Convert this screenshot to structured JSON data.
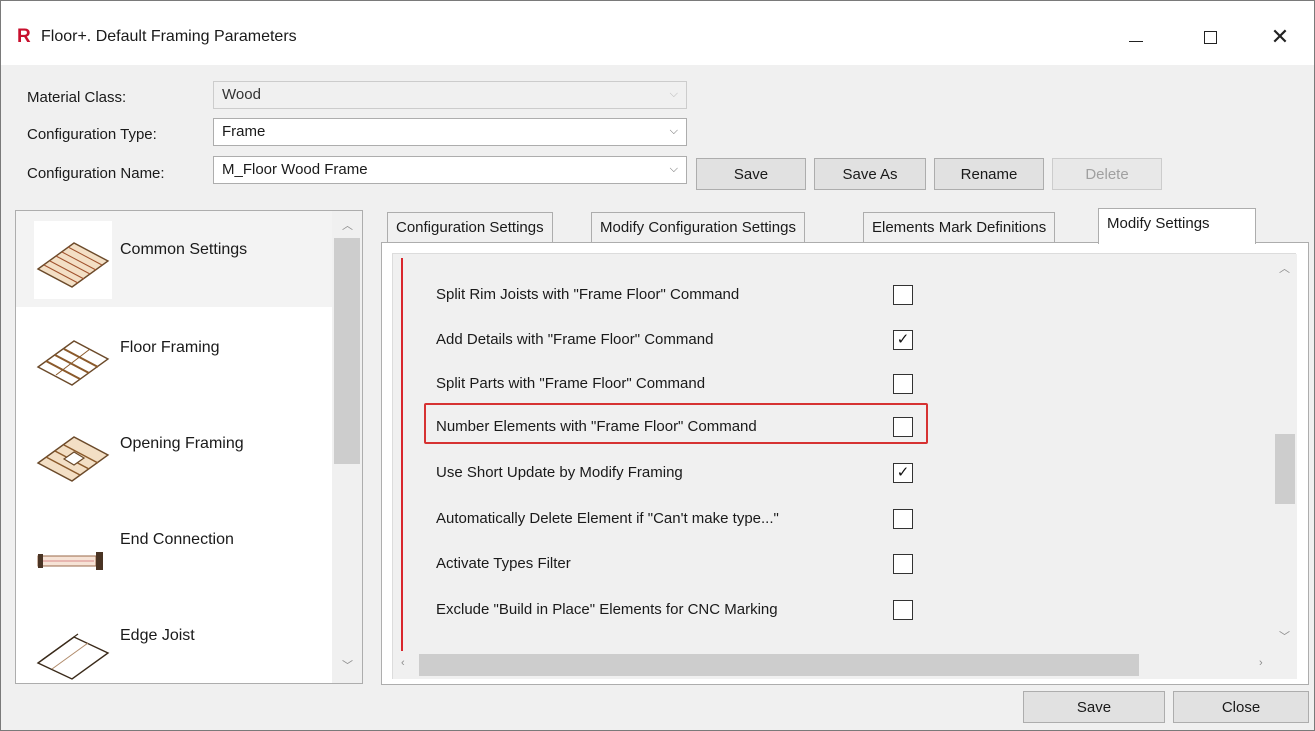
{
  "window": {
    "title": "Floor+. Default Framing Parameters",
    "app_icon_letter": "R",
    "accent_color": "#c8102e"
  },
  "form": {
    "material_class_label": "Material Class:",
    "material_class_value": "Wood",
    "configuration_type_label": "Configuration Type:",
    "configuration_type_value": "Frame",
    "configuration_name_label": "Configuration Name:",
    "configuration_name_value": "M_Floor Wood Frame",
    "save_label": "Save",
    "save_as_label": "Save As",
    "rename_label": "Rename",
    "delete_label": "Delete"
  },
  "left_list": {
    "items": [
      {
        "label": "Common Settings",
        "icon": "common-settings-icon",
        "selected": true
      },
      {
        "label": "Floor Framing",
        "icon": "floor-framing-icon",
        "selected": false
      },
      {
        "label": "Opening Framing",
        "icon": "opening-framing-icon",
        "selected": false
      },
      {
        "label": "End Connection",
        "icon": "end-connection-icon",
        "selected": false
      },
      {
        "label": "Edge Joist",
        "icon": "edge-joist-icon",
        "selected": false
      }
    ]
  },
  "tabs": [
    {
      "label": "Configuration Settings",
      "active": false
    },
    {
      "label": "Modify Configuration Settings",
      "active": false
    },
    {
      "label": "Elements Mark Definitions",
      "active": false
    },
    {
      "label": "Modify Settings",
      "active": true
    }
  ],
  "settings": [
    {
      "label": "Split Rim Joists with \"Frame Floor\" Command",
      "checked": false
    },
    {
      "label": "Add Details with \"Frame Floor\" Command",
      "checked": true
    },
    {
      "label": "Split Parts with \"Frame Floor\" Command",
      "checked": false
    },
    {
      "label": "Number Elements with \"Frame Floor\" Command",
      "checked": false
    },
    {
      "label": "Use Short Update by Modify Framing",
      "checked": true
    },
    {
      "label": "Automatically Delete Element if \"Can't make type...\"",
      "checked": false
    },
    {
      "label": "Activate Types Filter",
      "checked": false
    },
    {
      "label": "Exclude \"Build in Place\" Elements for CNC Marking",
      "checked": false
    }
  ],
  "footer": {
    "save_label": "Save",
    "close_label": "Close"
  },
  "colors": {
    "highlight_border": "#d63232",
    "marker_line": "#d9262c"
  }
}
